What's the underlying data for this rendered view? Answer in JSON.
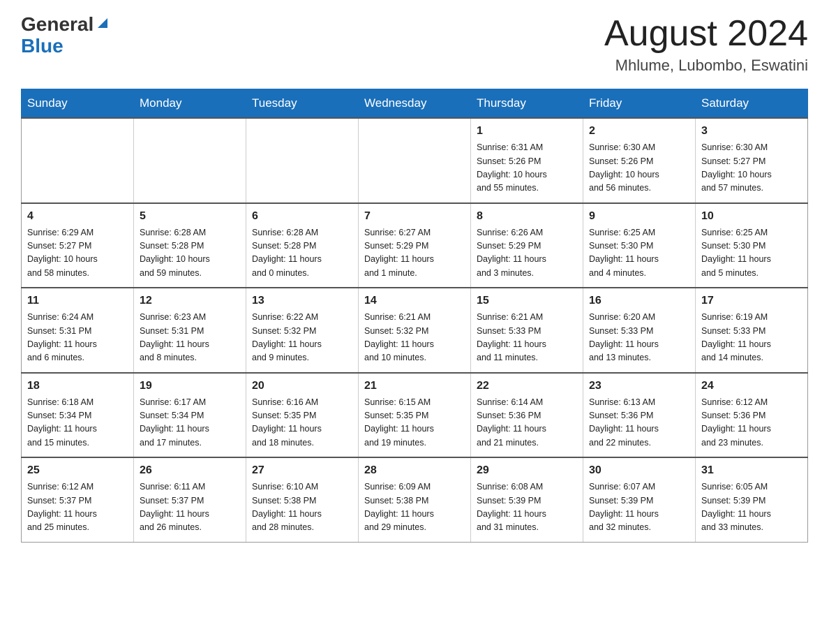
{
  "header": {
    "logo_general": "General",
    "logo_blue": "Blue",
    "month_title": "August 2024",
    "location": "Mhlume, Lubombo, Eswatini"
  },
  "days_of_week": [
    "Sunday",
    "Monday",
    "Tuesday",
    "Wednesday",
    "Thursday",
    "Friday",
    "Saturday"
  ],
  "weeks": [
    [
      {
        "day": "",
        "info": ""
      },
      {
        "day": "",
        "info": ""
      },
      {
        "day": "",
        "info": ""
      },
      {
        "day": "",
        "info": ""
      },
      {
        "day": "1",
        "info": "Sunrise: 6:31 AM\nSunset: 5:26 PM\nDaylight: 10 hours\nand 55 minutes."
      },
      {
        "day": "2",
        "info": "Sunrise: 6:30 AM\nSunset: 5:26 PM\nDaylight: 10 hours\nand 56 minutes."
      },
      {
        "day": "3",
        "info": "Sunrise: 6:30 AM\nSunset: 5:27 PM\nDaylight: 10 hours\nand 57 minutes."
      }
    ],
    [
      {
        "day": "4",
        "info": "Sunrise: 6:29 AM\nSunset: 5:27 PM\nDaylight: 10 hours\nand 58 minutes."
      },
      {
        "day": "5",
        "info": "Sunrise: 6:28 AM\nSunset: 5:28 PM\nDaylight: 10 hours\nand 59 minutes."
      },
      {
        "day": "6",
        "info": "Sunrise: 6:28 AM\nSunset: 5:28 PM\nDaylight: 11 hours\nand 0 minutes."
      },
      {
        "day": "7",
        "info": "Sunrise: 6:27 AM\nSunset: 5:29 PM\nDaylight: 11 hours\nand 1 minute."
      },
      {
        "day": "8",
        "info": "Sunrise: 6:26 AM\nSunset: 5:29 PM\nDaylight: 11 hours\nand 3 minutes."
      },
      {
        "day": "9",
        "info": "Sunrise: 6:25 AM\nSunset: 5:30 PM\nDaylight: 11 hours\nand 4 minutes."
      },
      {
        "day": "10",
        "info": "Sunrise: 6:25 AM\nSunset: 5:30 PM\nDaylight: 11 hours\nand 5 minutes."
      }
    ],
    [
      {
        "day": "11",
        "info": "Sunrise: 6:24 AM\nSunset: 5:31 PM\nDaylight: 11 hours\nand 6 minutes."
      },
      {
        "day": "12",
        "info": "Sunrise: 6:23 AM\nSunset: 5:31 PM\nDaylight: 11 hours\nand 8 minutes."
      },
      {
        "day": "13",
        "info": "Sunrise: 6:22 AM\nSunset: 5:32 PM\nDaylight: 11 hours\nand 9 minutes."
      },
      {
        "day": "14",
        "info": "Sunrise: 6:21 AM\nSunset: 5:32 PM\nDaylight: 11 hours\nand 10 minutes."
      },
      {
        "day": "15",
        "info": "Sunrise: 6:21 AM\nSunset: 5:33 PM\nDaylight: 11 hours\nand 11 minutes."
      },
      {
        "day": "16",
        "info": "Sunrise: 6:20 AM\nSunset: 5:33 PM\nDaylight: 11 hours\nand 13 minutes."
      },
      {
        "day": "17",
        "info": "Sunrise: 6:19 AM\nSunset: 5:33 PM\nDaylight: 11 hours\nand 14 minutes."
      }
    ],
    [
      {
        "day": "18",
        "info": "Sunrise: 6:18 AM\nSunset: 5:34 PM\nDaylight: 11 hours\nand 15 minutes."
      },
      {
        "day": "19",
        "info": "Sunrise: 6:17 AM\nSunset: 5:34 PM\nDaylight: 11 hours\nand 17 minutes."
      },
      {
        "day": "20",
        "info": "Sunrise: 6:16 AM\nSunset: 5:35 PM\nDaylight: 11 hours\nand 18 minutes."
      },
      {
        "day": "21",
        "info": "Sunrise: 6:15 AM\nSunset: 5:35 PM\nDaylight: 11 hours\nand 19 minutes."
      },
      {
        "day": "22",
        "info": "Sunrise: 6:14 AM\nSunset: 5:36 PM\nDaylight: 11 hours\nand 21 minutes."
      },
      {
        "day": "23",
        "info": "Sunrise: 6:13 AM\nSunset: 5:36 PM\nDaylight: 11 hours\nand 22 minutes."
      },
      {
        "day": "24",
        "info": "Sunrise: 6:12 AM\nSunset: 5:36 PM\nDaylight: 11 hours\nand 23 minutes."
      }
    ],
    [
      {
        "day": "25",
        "info": "Sunrise: 6:12 AM\nSunset: 5:37 PM\nDaylight: 11 hours\nand 25 minutes."
      },
      {
        "day": "26",
        "info": "Sunrise: 6:11 AM\nSunset: 5:37 PM\nDaylight: 11 hours\nand 26 minutes."
      },
      {
        "day": "27",
        "info": "Sunrise: 6:10 AM\nSunset: 5:38 PM\nDaylight: 11 hours\nand 28 minutes."
      },
      {
        "day": "28",
        "info": "Sunrise: 6:09 AM\nSunset: 5:38 PM\nDaylight: 11 hours\nand 29 minutes."
      },
      {
        "day": "29",
        "info": "Sunrise: 6:08 AM\nSunset: 5:39 PM\nDaylight: 11 hours\nand 31 minutes."
      },
      {
        "day": "30",
        "info": "Sunrise: 6:07 AM\nSunset: 5:39 PM\nDaylight: 11 hours\nand 32 minutes."
      },
      {
        "day": "31",
        "info": "Sunrise: 6:05 AM\nSunset: 5:39 PM\nDaylight: 11 hours\nand 33 minutes."
      }
    ]
  ]
}
